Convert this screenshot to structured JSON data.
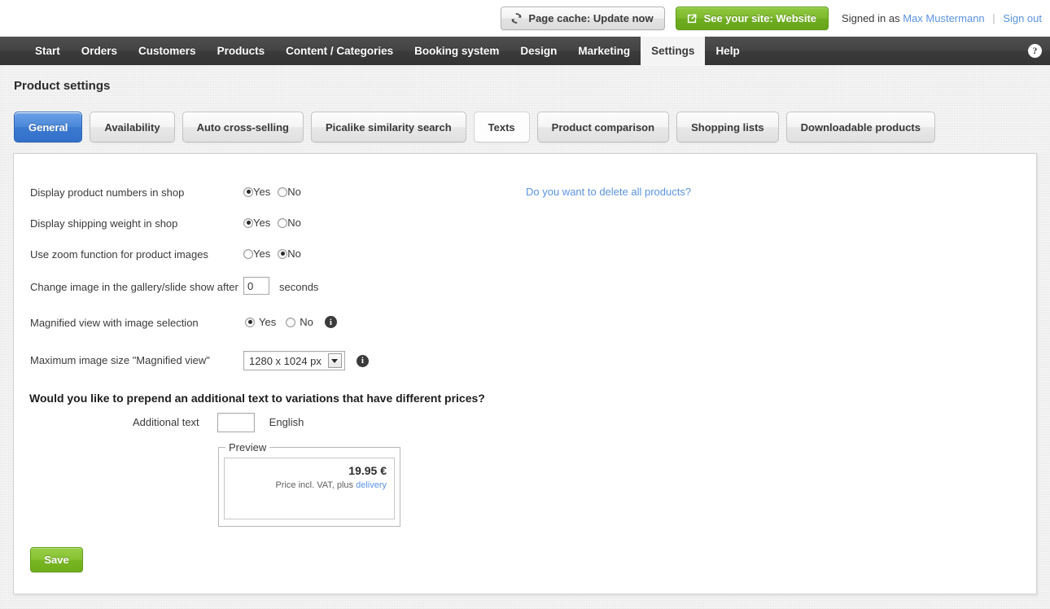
{
  "topbar": {
    "cache_button": "Page cache: Update now",
    "cache_icon": "refresh-icon",
    "site_button": "See your site: Website",
    "site_icon": "external-link-icon",
    "signed_in_label": "Signed in as",
    "user_name": "Max Mustermann",
    "separator": "|",
    "sign_out": "Sign out"
  },
  "nav": {
    "items": [
      {
        "label": "Start",
        "active": false
      },
      {
        "label": "Orders",
        "active": false
      },
      {
        "label": "Customers",
        "active": false
      },
      {
        "label": "Products",
        "active": false
      },
      {
        "label": "Content / Categories",
        "active": false
      },
      {
        "label": "Booking system",
        "active": false
      },
      {
        "label": "Design",
        "active": false
      },
      {
        "label": "Marketing",
        "active": false
      },
      {
        "label": "Settings",
        "active": true
      },
      {
        "label": "Help",
        "active": false
      }
    ],
    "help_icon_glyph": "?"
  },
  "page": {
    "title": "Product settings"
  },
  "subtabs": [
    {
      "label": "General",
      "active": true
    },
    {
      "label": "Availability",
      "active": false
    },
    {
      "label": "Auto cross-selling",
      "active": false
    },
    {
      "label": "Picalike similarity search",
      "active": false
    },
    {
      "label": "Texts",
      "active": false
    },
    {
      "label": "Product comparison",
      "active": false
    },
    {
      "label": "Shopping lists",
      "active": false
    },
    {
      "label": "Downloadable products",
      "active": false
    }
  ],
  "form": {
    "row_product_numbers": {
      "label": "Display product numbers in shop",
      "yes": "Yes",
      "no": "No",
      "value": "Yes"
    },
    "row_shipping_weight": {
      "label": "Display shipping weight in shop",
      "yes": "Yes",
      "no": "No",
      "value": "Yes"
    },
    "row_zoom_function": {
      "label": "Use zoom function for product images",
      "yes": "Yes",
      "no": "No",
      "value": "No"
    },
    "row_gallery_interval": {
      "label": "Change image in the gallery/slide show af­ter",
      "value": "0",
      "unit": "seconds"
    },
    "row_magnified_view": {
      "label": "Magnified view with image selection",
      "yes": "Yes",
      "no": "No",
      "value": "Yes",
      "info_glyph": "i"
    },
    "row_max_image_size": {
      "label": "Maximum image size \"Magnified view\"",
      "selected": "1280 x 1024 px",
      "info_glyph": "i"
    },
    "delete_products_link": "Do you want to delete all products?",
    "section_heading": "Would you like to prepend an additional text to variations that have different prices?",
    "additional_text": {
      "label": "Additional text",
      "value": "",
      "language": "English"
    },
    "preview": {
      "legend": "Preview",
      "price": "19.95 €",
      "note_prefix": "Price incl. VAT, plus ",
      "note_link": "delivery"
    },
    "save_label": "Save"
  }
}
